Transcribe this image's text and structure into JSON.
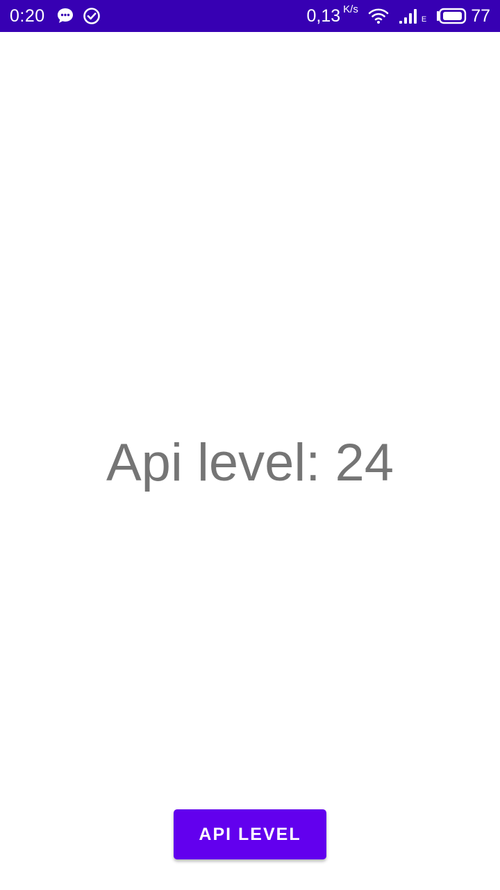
{
  "status_bar": {
    "time": "0:20",
    "speed_value": "0,13",
    "speed_unit": "K/s",
    "network_type": "E",
    "battery_level": "77",
    "icons": [
      "chat-bubble-icon",
      "check-circle-icon",
      "wifi-icon",
      "signal-icon",
      "battery-icon"
    ],
    "background": "#3700b3"
  },
  "main": {
    "api_text": "Api level: 24",
    "button_label": "API LEVEL",
    "button_color": "#6200ee",
    "text_color": "#757575"
  }
}
